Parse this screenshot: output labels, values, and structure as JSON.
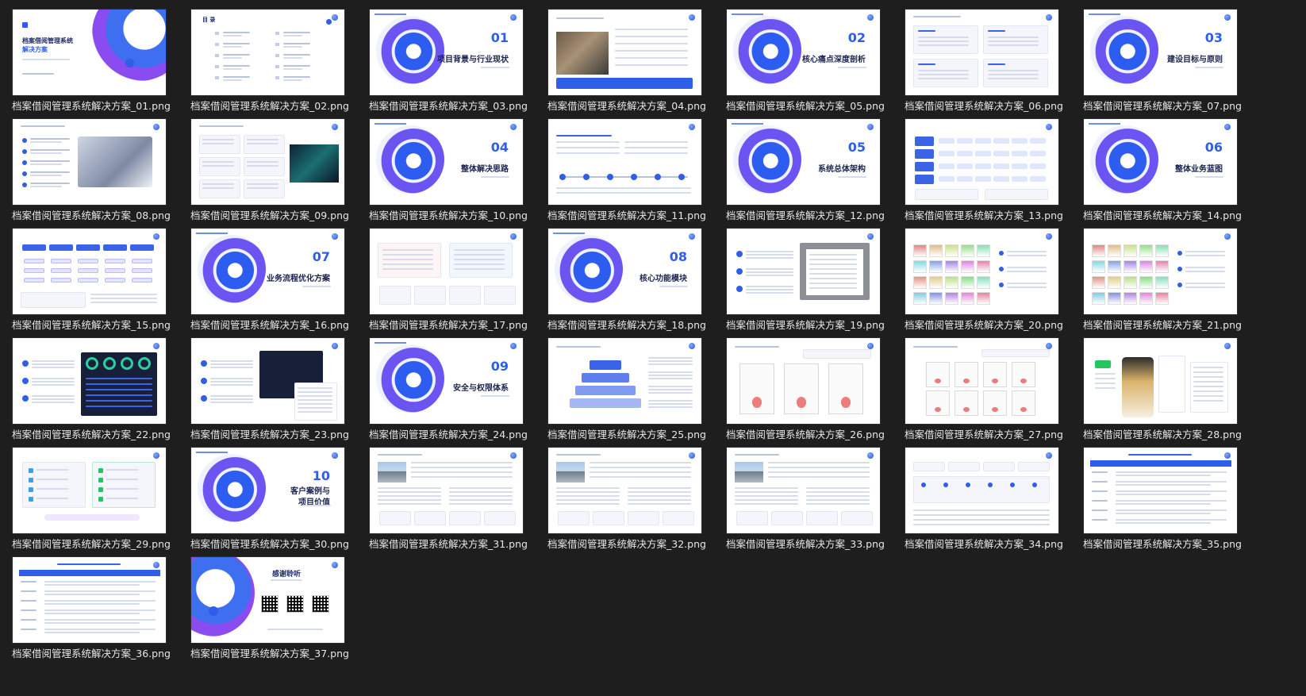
{
  "files": [
    {
      "name": "档案借阅管理系统解决方案_01.png",
      "kind": "cover",
      "title_lines": [
        "档案借阅管理系统",
        "解决方案"
      ]
    },
    {
      "name": "档案借阅管理系统解决方案_02.png",
      "kind": "toc",
      "title": "目 录"
    },
    {
      "name": "档案借阅管理系统解决方案_03.png",
      "kind": "section",
      "num": "01",
      "title": "项目背景与行业现状"
    },
    {
      "name": "档案借阅管理系统解决方案_04.png",
      "kind": "photo-left"
    },
    {
      "name": "档案借阅管理系统解决方案_05.png",
      "kind": "section",
      "num": "02",
      "title": "核心痛点深度剖析"
    },
    {
      "name": "档案借阅管理系统解决方案_06.png",
      "kind": "cards4"
    },
    {
      "name": "档案借阅管理系统解决方案_07.png",
      "kind": "section",
      "num": "03",
      "title": "建设目标与原则"
    },
    {
      "name": "档案借阅管理系统解决方案_08.png",
      "kind": "list-laptop"
    },
    {
      "name": "档案借阅管理系统解决方案_09.png",
      "kind": "cards-dark"
    },
    {
      "name": "档案借阅管理系统解决方案_10.png",
      "kind": "section",
      "num": "04",
      "title": "整体解决思路"
    },
    {
      "name": "档案借阅管理系统解决方案_11.png",
      "kind": "timeline"
    },
    {
      "name": "档案借阅管理系统解决方案_12.png",
      "kind": "section",
      "num": "05",
      "title": "系统总体架构"
    },
    {
      "name": "档案借阅管理系统解决方案_13.png",
      "kind": "architecture"
    },
    {
      "name": "档案借阅管理系统解决方案_14.png",
      "kind": "section",
      "num": "06",
      "title": "整体业务蓝图"
    },
    {
      "name": "档案借阅管理系统解决方案_15.png",
      "kind": "flow"
    },
    {
      "name": "档案借阅管理系统解决方案_16.png",
      "kind": "section",
      "num": "07",
      "title": "业务流程优化方案"
    },
    {
      "name": "档案借阅管理系统解决方案_17.png",
      "kind": "compare"
    },
    {
      "name": "档案借阅管理系统解决方案_18.png",
      "kind": "section",
      "num": "08",
      "title": "核心功能模块"
    },
    {
      "name": "档案借阅管理系统解决方案_19.png",
      "kind": "screenshot-right"
    },
    {
      "name": "档案借阅管理系统解决方案_20.png",
      "kind": "screens-grid"
    },
    {
      "name": "档案借阅管理系统解决方案_21.png",
      "kind": "screens-grid"
    },
    {
      "name": "档案借阅管理系统解决方案_22.png",
      "kind": "dashboard"
    },
    {
      "name": "档案借阅管理系统解决方案_23.png",
      "kind": "dashboard2"
    },
    {
      "name": "档案借阅管理系统解决方案_24.png",
      "kind": "section",
      "num": "09",
      "title": "安全与权限体系"
    },
    {
      "name": "档案借阅管理系统解决方案_25.png",
      "kind": "pyramid"
    },
    {
      "name": "档案借阅管理系统解决方案_26.png",
      "kind": "certs3"
    },
    {
      "name": "档案借阅管理系统解决方案_27.png",
      "kind": "certs8"
    },
    {
      "name": "档案借阅管理系统解决方案_28.png",
      "kind": "mobile"
    },
    {
      "name": "档案借阅管理系统解决方案_29.png",
      "kind": "service"
    },
    {
      "name": "档案借阅管理系统解决方案_30.png",
      "kind": "section",
      "num": "10",
      "title": "客户案例与项目价值",
      "title_lines": [
        "客户案例与",
        "项目价值"
      ]
    },
    {
      "name": "档案借阅管理系统解决方案_31.png",
      "kind": "case"
    },
    {
      "name": "档案借阅管理系统解决方案_32.png",
      "kind": "case"
    },
    {
      "name": "档案借阅管理系统解决方案_33.png",
      "kind": "case"
    },
    {
      "name": "档案借阅管理系统解决方案_34.png",
      "kind": "value"
    },
    {
      "name": "档案借阅管理系统解决方案_35.png",
      "kind": "table"
    },
    {
      "name": "档案借阅管理系统解决方案_36.png",
      "kind": "table"
    },
    {
      "name": "档案借阅管理系统解决方案_37.png",
      "kind": "thanks",
      "title": "感谢聆听"
    }
  ]
}
